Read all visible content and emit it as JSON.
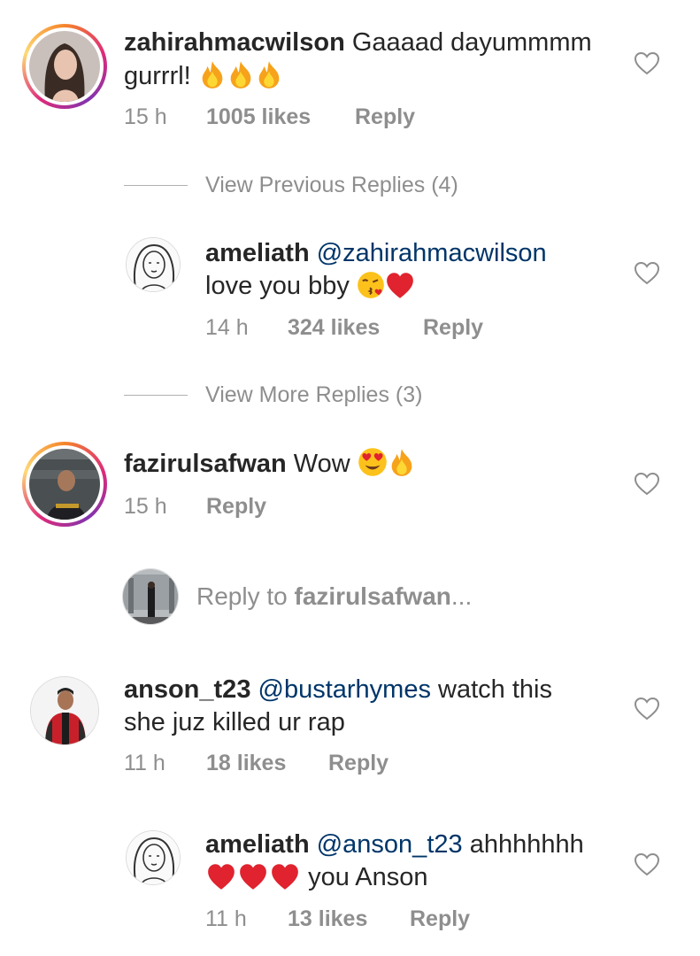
{
  "comments": [
    {
      "username": "zahirahmacwilson",
      "text": "Gaaaad dayummmm",
      "text2": "gurrrl!",
      "time": "15 h",
      "likes": "1005 likes",
      "reply": "Reply"
    },
    {
      "username": "ameliath",
      "mention": "@zahirahmacwilson",
      "text": "love you bby",
      "time": "14 h",
      "likes": "324 likes",
      "reply": "Reply"
    },
    {
      "username": "fazirulsafwan",
      "text": "Wow",
      "time": "15 h",
      "reply": "Reply"
    },
    {
      "username": "anson_t23",
      "mention": "@bustarhymes",
      "text": "watch this",
      "text2": "she juz killed ur rap",
      "time": "11 h",
      "likes": "18 likes",
      "reply": "Reply"
    },
    {
      "username": "ameliath",
      "mention": "@anson_t23",
      "text": "ahhhhhhh",
      "text2": "you Anson",
      "time": "11 h",
      "likes": "13 likes",
      "reply": "Reply"
    }
  ],
  "view_previous": "View Previous Replies (4)",
  "view_more": "View More Replies (3)",
  "reply_prompt": {
    "prefix": "Reply to ",
    "username": "fazirulsafwan",
    "suffix": "..."
  },
  "colors": {
    "text": "#262626",
    "muted": "#8e8e8e",
    "mention": "#003569",
    "story_ring": "#dd2a7b"
  },
  "icons": [
    "heart-outline-icon",
    "fire-emoji",
    "kiss-emoji",
    "red-heart-emoji",
    "heart-eyes-emoji"
  ]
}
